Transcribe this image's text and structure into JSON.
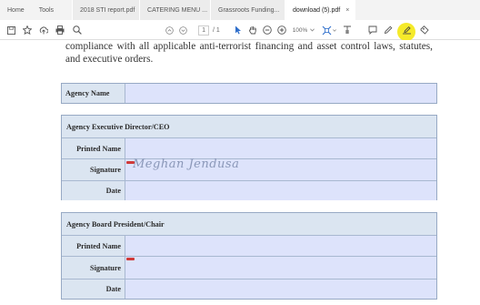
{
  "tabs": {
    "home": "Home",
    "tools": "Tools",
    "documents": [
      {
        "label": "2018 STI report.pdf",
        "close": ""
      },
      {
        "label": "CATERING MENU ...",
        "close": "×"
      },
      {
        "label": "Grassroots Funding...",
        "close": ""
      },
      {
        "label": "download (5).pdf",
        "close": "×"
      }
    ]
  },
  "toolbar": {
    "page_current": "1",
    "page_total": "/ 1",
    "zoom": "100%",
    "highlight_color": "#f5ea2a",
    "icons": [
      "save-icon",
      "bookmark-icon",
      "upload-icon",
      "print-icon",
      "search-icon",
      "prev-page-icon",
      "next-page-icon",
      "select-cursor-icon",
      "hand-tool-icon",
      "zoom-out-icon",
      "zoom-in-icon",
      "zoom-dropdown-icon",
      "fit-page-icon",
      "scroll-mode-icon",
      "comment-icon",
      "pen-icon",
      "sign-icon",
      "stamp-icon"
    ]
  },
  "document": {
    "intro_text": "compliance with all applicable anti-terrorist financing and asset control laws, statutes, and executive orders.",
    "agency_name_label": "Agency Name",
    "section1": {
      "heading": "Agency Executive Director/CEO",
      "printed_name_label": "Printed Name",
      "signature_label": "Signature",
      "signature_value": "Meghan Jendusa",
      "date_label": "Date"
    },
    "section2": {
      "heading": "Agency Board President/Chair",
      "printed_name_label": "Printed Name",
      "signature_label": "Signature",
      "date_label": "Date"
    }
  }
}
